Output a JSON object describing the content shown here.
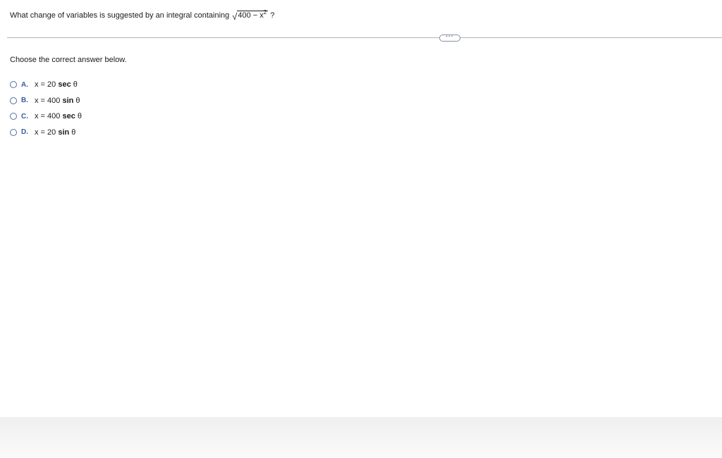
{
  "question": {
    "text": "What change of variables is suggested by an integral containing",
    "radical_sign": "√",
    "radicand_base": "400 − x",
    "radicand_exponent": "2",
    "question_mark": "?"
  },
  "toolbar": {
    "more_label": "···"
  },
  "prompt": "Choose the correct answer below.",
  "options": [
    {
      "letter": "A.",
      "lhs": "x = 20 ",
      "fn": "sec",
      "var": " θ"
    },
    {
      "letter": "B.",
      "lhs": "x = 400 ",
      "fn": "sin",
      "var": " θ"
    },
    {
      "letter": "C.",
      "lhs": "x = 400 ",
      "fn": "sec",
      "var": " θ"
    },
    {
      "letter": "D.",
      "lhs": "x = 20 ",
      "fn": "sin",
      "var": " θ"
    }
  ],
  "colors": {
    "accent": "#3a5aa0",
    "radio_border": "#4a6fa8",
    "divider": "#b5b5b5"
  }
}
